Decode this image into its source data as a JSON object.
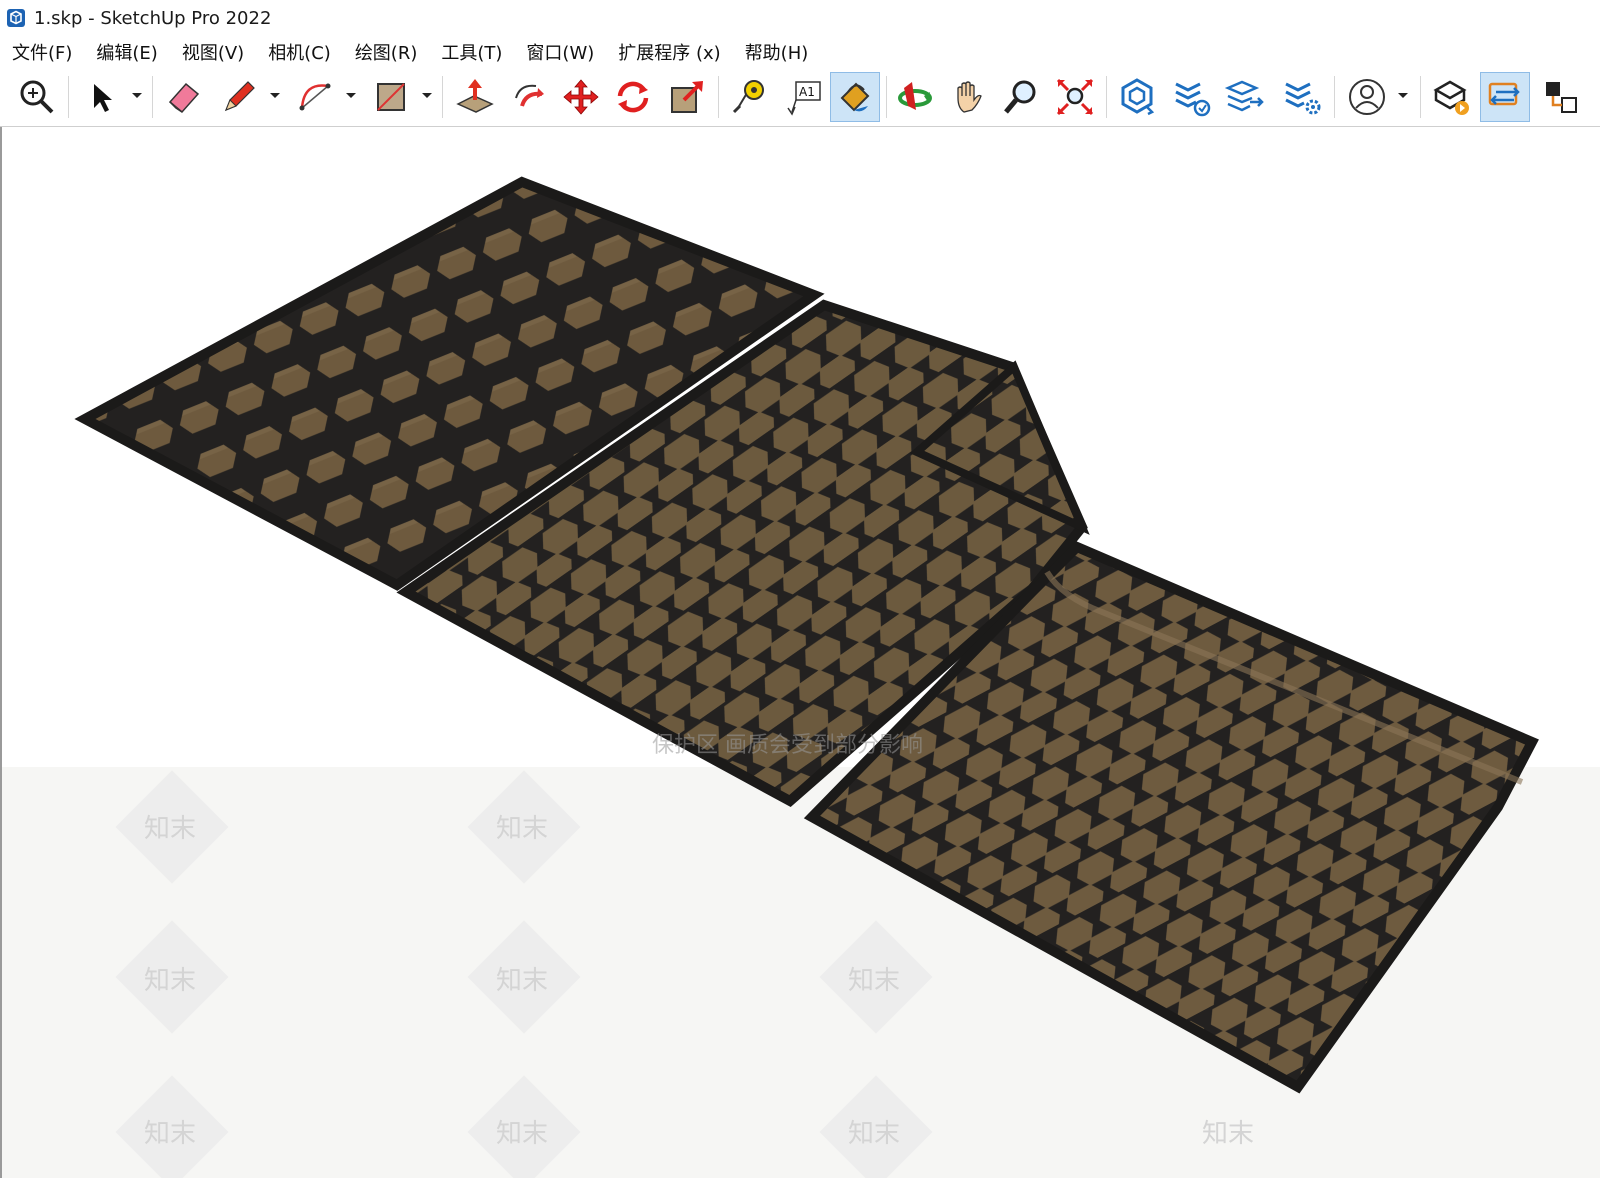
{
  "window": {
    "title": "1.skp - SketchUp Pro 2022"
  },
  "menu": {
    "items": [
      "文件(F)",
      "编辑(E)",
      "视图(V)",
      "相机(C)",
      "绘图(R)",
      "工具(T)",
      "窗口(W)",
      "扩展程序 (x)",
      "帮助(H)"
    ]
  },
  "toolbar": {
    "text_tool_label": "A1",
    "tools": [
      "zoom-extents-icon",
      "select-icon",
      "eraser-icon",
      "pencil-icon",
      "arc-icon",
      "rectangle-icon",
      "push-pull-icon",
      "follow-me-icon",
      "move-icon",
      "rotate-icon",
      "scale-icon",
      "tape-measure-icon",
      "text-icon",
      "paint-bucket-icon",
      "orbit-icon",
      "pan-icon",
      "zoom-icon",
      "zoom-window-icon",
      "warehouse-icon",
      "extension-warehouse-icon",
      "layout-send-icon",
      "extension-manager-icon",
      "account-icon",
      "add-location-icon",
      "export-icon",
      "component-icon"
    ]
  },
  "viewport": {
    "watermark_banner": "保护区   画质会受到部分影响",
    "watermark_mark": "知末"
  },
  "colors": {
    "tile_fill": "#6e5a3e",
    "lattice": "#232120",
    "accent_blue": "#1e6fc0"
  }
}
